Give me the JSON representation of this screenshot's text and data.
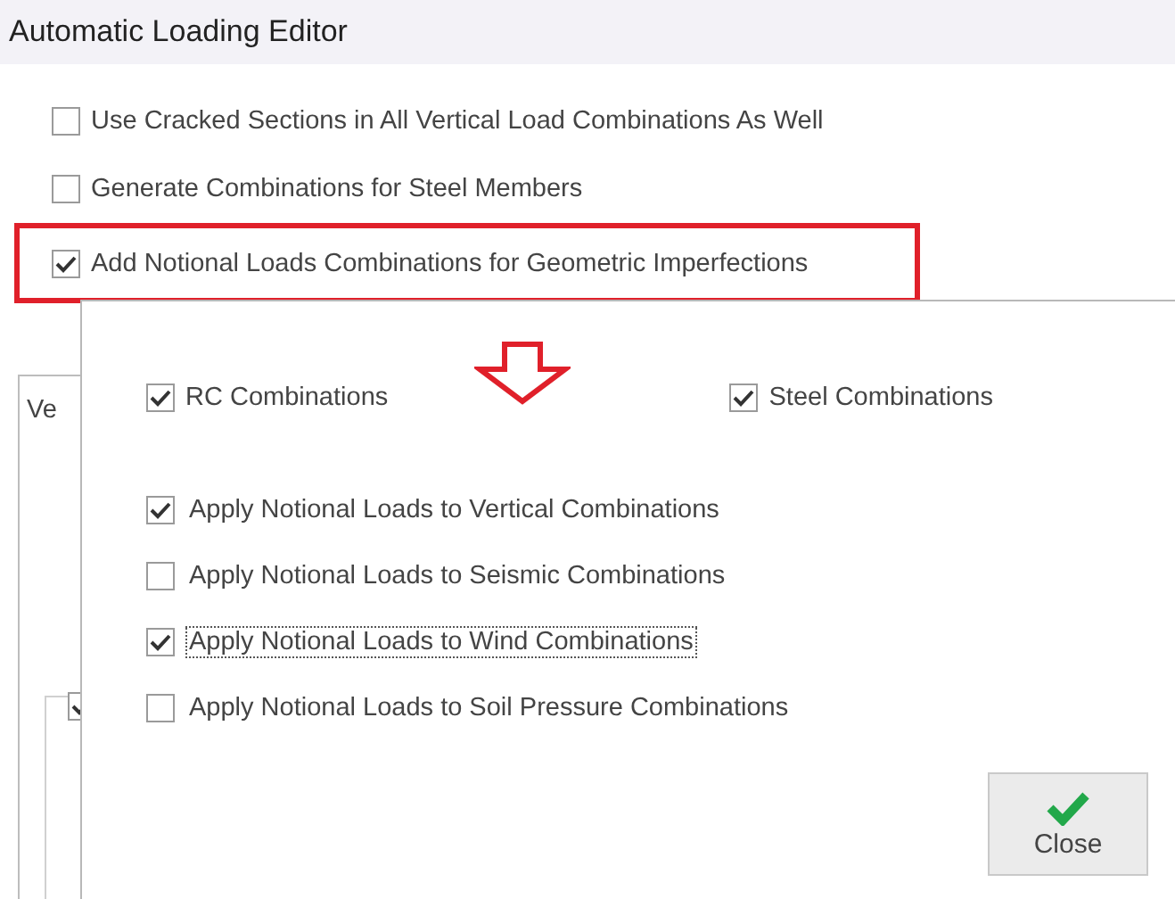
{
  "window": {
    "title": "Automatic Loading Editor"
  },
  "options": [
    {
      "label": "Use Cracked Sections in All Vertical Load Combinations As Well",
      "checked": false,
      "highlighted": false
    },
    {
      "label": "Generate Combinations for Steel Members",
      "checked": false,
      "highlighted": false
    },
    {
      "label": "Add Notional Loads Combinations for Geometric Imperfections",
      "checked": true,
      "highlighted": true
    }
  ],
  "background_group": {
    "label": "Ve",
    "checkbox_checked": true
  },
  "popup": {
    "types": [
      {
        "label": "RC Combinations",
        "checked": true
      },
      {
        "label": "Steel Combinations",
        "checked": true
      }
    ],
    "apply": [
      {
        "label": "Apply Notional Loads to Vertical Combinations",
        "checked": true,
        "focused": false
      },
      {
        "label": "Apply Notional Loads to Seismic Combinations",
        "checked": false,
        "focused": false
      },
      {
        "label": "Apply Notional Loads to Wind Combinations",
        "checked": true,
        "focused": true
      },
      {
        "label": "Apply Notional Loads to Soil Pressure Combinations",
        "checked": false,
        "focused": false
      }
    ],
    "close_button": {
      "label": "Close"
    }
  }
}
